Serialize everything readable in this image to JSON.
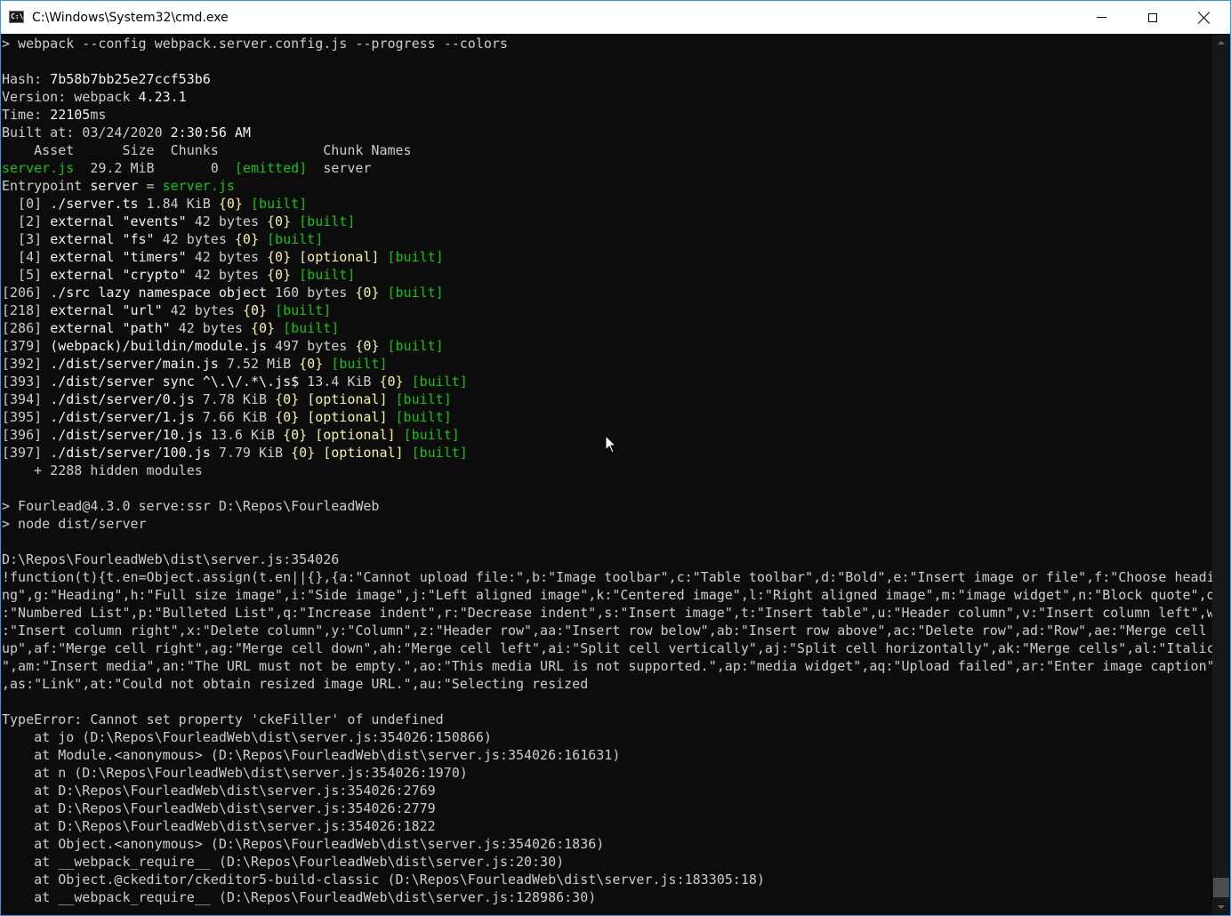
{
  "window": {
    "title": "C:\\Windows\\System32\\cmd.exe",
    "icon_label": "C:\\",
    "icon": "cmd-app-icon"
  },
  "console": {
    "lines": [
      [
        {
          "t": "> webpack --config webpack.server.config.js --progress --colors"
        }
      ],
      [
        {
          "t": ""
        }
      ],
      [
        {
          "t": "Hash: "
        },
        {
          "t": "7b58b7bb25e27ccf53b6",
          "c": "w"
        }
      ],
      [
        {
          "t": "Version: webpack "
        },
        {
          "t": "4.23.1",
          "c": "w"
        }
      ],
      [
        {
          "t": "Time: "
        },
        {
          "t": "22105",
          "c": "w"
        },
        {
          "t": "ms"
        }
      ],
      [
        {
          "t": "Built at: 03/24/2020 "
        },
        {
          "t": "2:30:56 AM",
          "c": "w"
        }
      ],
      [
        {
          "t": "    Asset      Size  Chunks             Chunk Names"
        }
      ],
      [
        {
          "t": "server.js",
          "c": "lg"
        },
        {
          "t": "  29.2 MiB       0  "
        },
        {
          "t": "[emitted]",
          "c": "lg"
        },
        {
          "t": "  server"
        }
      ],
      [
        {
          "t": "Entrypoint "
        },
        {
          "t": "server",
          "c": "w"
        },
        {
          "t": " = "
        },
        {
          "t": "server.js",
          "c": "lg"
        }
      ],
      [
        {
          "t": "  [0] "
        },
        {
          "t": "./server.ts",
          "c": "w"
        },
        {
          "t": " 1.84 KiB "
        },
        {
          "t": "{",
          "c": "y"
        },
        {
          "t": "0",
          "c": "yy"
        },
        {
          "t": "}",
          "c": "y"
        },
        {
          "t": " "
        },
        {
          "t": "[built]",
          "c": "lg"
        }
      ],
      [
        {
          "t": "  [2] "
        },
        {
          "t": "external \"events\"",
          "c": "w"
        },
        {
          "t": " 42 bytes "
        },
        {
          "t": "{0}",
          "c": "yy"
        },
        {
          "t": " "
        },
        {
          "t": "[built]",
          "c": "lg"
        }
      ],
      [
        {
          "t": "  [3] "
        },
        {
          "t": "external \"fs\"",
          "c": "w"
        },
        {
          "t": " 42 bytes "
        },
        {
          "t": "{0}",
          "c": "yy"
        },
        {
          "t": " "
        },
        {
          "t": "[built]",
          "c": "lg"
        }
      ],
      [
        {
          "t": "  [4] "
        },
        {
          "t": "external \"timers\"",
          "c": "w"
        },
        {
          "t": " 42 bytes "
        },
        {
          "t": "{0}",
          "c": "yy"
        },
        {
          "t": " "
        },
        {
          "t": "[optional]",
          "c": "yy"
        },
        {
          "t": " "
        },
        {
          "t": "[built]",
          "c": "lg"
        }
      ],
      [
        {
          "t": "  [5] "
        },
        {
          "t": "external \"crypto\"",
          "c": "w"
        },
        {
          "t": " 42 bytes "
        },
        {
          "t": "{0}",
          "c": "yy"
        },
        {
          "t": " "
        },
        {
          "t": "[built]",
          "c": "lg"
        }
      ],
      [
        {
          "t": "[206] "
        },
        {
          "t": "./src lazy namespace object",
          "c": "w"
        },
        {
          "t": " 160 bytes "
        },
        {
          "t": "{0}",
          "c": "yy"
        },
        {
          "t": " "
        },
        {
          "t": "[built]",
          "c": "lg"
        }
      ],
      [
        {
          "t": "[218] "
        },
        {
          "t": "external \"url\"",
          "c": "w"
        },
        {
          "t": " 42 bytes "
        },
        {
          "t": "{0}",
          "c": "yy"
        },
        {
          "t": " "
        },
        {
          "t": "[built]",
          "c": "lg"
        }
      ],
      [
        {
          "t": "[286] "
        },
        {
          "t": "external \"path\"",
          "c": "w"
        },
        {
          "t": " 42 bytes "
        },
        {
          "t": "{0}",
          "c": "yy"
        },
        {
          "t": " "
        },
        {
          "t": "[built]",
          "c": "lg"
        }
      ],
      [
        {
          "t": "[379] "
        },
        {
          "t": "(webpack)/buildin/module.js",
          "c": "w"
        },
        {
          "t": " 497 bytes "
        },
        {
          "t": "{0}",
          "c": "yy"
        },
        {
          "t": " "
        },
        {
          "t": "[built]",
          "c": "lg"
        }
      ],
      [
        {
          "t": "[392] "
        },
        {
          "t": "./dist/server/main.js",
          "c": "w"
        },
        {
          "t": " 7.52 MiB "
        },
        {
          "t": "{0}",
          "c": "yy"
        },
        {
          "t": " "
        },
        {
          "t": "[built]",
          "c": "lg"
        }
      ],
      [
        {
          "t": "[393] "
        },
        {
          "t": "./dist/server sync ^\\.\\/.*\\.js$",
          "c": "w"
        },
        {
          "t": " 13.4 KiB "
        },
        {
          "t": "{0}",
          "c": "yy"
        },
        {
          "t": " "
        },
        {
          "t": "[built]",
          "c": "lg"
        }
      ],
      [
        {
          "t": "[394] "
        },
        {
          "t": "./dist/server/0.js",
          "c": "w"
        },
        {
          "t": " 7.78 KiB "
        },
        {
          "t": "{0}",
          "c": "yy"
        },
        {
          "t": " "
        },
        {
          "t": "[optional]",
          "c": "yy"
        },
        {
          "t": " "
        },
        {
          "t": "[built]",
          "c": "lg"
        }
      ],
      [
        {
          "t": "[395] "
        },
        {
          "t": "./dist/server/1.js",
          "c": "w"
        },
        {
          "t": " 7.66 KiB "
        },
        {
          "t": "{0}",
          "c": "yy"
        },
        {
          "t": " "
        },
        {
          "t": "[optional]",
          "c": "yy"
        },
        {
          "t": " "
        },
        {
          "t": "[built]",
          "c": "lg"
        }
      ],
      [
        {
          "t": "[396] "
        },
        {
          "t": "./dist/server/10.js",
          "c": "w"
        },
        {
          "t": " 13.6 KiB "
        },
        {
          "t": "{0}",
          "c": "yy"
        },
        {
          "t": " "
        },
        {
          "t": "[optional]",
          "c": "yy"
        },
        {
          "t": " "
        },
        {
          "t": "[built]",
          "c": "lg"
        }
      ],
      [
        {
          "t": "[397] "
        },
        {
          "t": "./dist/server/100.js",
          "c": "w"
        },
        {
          "t": " 7.79 KiB "
        },
        {
          "t": "{0}",
          "c": "yy"
        },
        {
          "t": " "
        },
        {
          "t": "[optional]",
          "c": "yy"
        },
        {
          "t": " "
        },
        {
          "t": "[built]",
          "c": "lg"
        }
      ],
      [
        {
          "t": "    + 2288 hidden modules"
        }
      ],
      [
        {
          "t": ""
        }
      ],
      [
        {
          "t": "> Fourlead@4.3.0 serve:ssr D:\\Repos\\FourleadWeb"
        }
      ],
      [
        {
          "t": "> node dist/server"
        }
      ],
      [
        {
          "t": ""
        }
      ],
      [
        {
          "t": "D:\\Repos\\FourleadWeb\\dist\\server.js:354026"
        }
      ],
      [
        {
          "t": "!function(t){t.en=Object.assign(t.en||{},{a:\"Cannot upload file:\",b:\"Image toolbar\",c:\"Table toolbar\",d:\"Bold\",e:\"Insert image or file\",f:\"Choose headi"
        }
      ],
      [
        {
          "t": "ng\",g:\"Heading\",h:\"Full size image\",i:\"Side image\",j:\"Left aligned image\",k:\"Centered image\",l:\"Right aligned image\",m:\"image widget\",n:\"Block quote\",o"
        }
      ],
      [
        {
          "t": ":\"Numbered List\",p:\"Bulleted List\",q:\"Increase indent\",r:\"Decrease indent\",s:\"Insert image\",t:\"Insert table\",u:\"Header column\",v:\"Insert column left\",w"
        }
      ],
      [
        {
          "t": ":\"Insert column right\",x:\"Delete column\",y:\"Column\",z:\"Header row\",aa:\"Insert row below\",ab:\"Insert row above\",ac:\"Delete row\",ad:\"Row\",ae:\"Merge cell "
        }
      ],
      [
        {
          "t": "up\",af:\"Merge cell right\",ag:\"Merge cell down\",ah:\"Merge cell left\",ai:\"Split cell vertically\",aj:\"Split cell horizontally\",ak:\"Merge cells\",al:\"Italic"
        }
      ],
      [
        {
          "t": "\",am:\"Insert media\",an:\"The URL must not be empty.\",ao:\"This media URL is not supported.\",ap:\"media widget\",aq:\"Upload failed\",ar:\"Enter image caption\""
        }
      ],
      [
        {
          "t": ",as:\"Link\",at:\"Could not obtain resized image URL.\",au:\"Selecting resized"
        }
      ],
      [
        {
          "t": ""
        }
      ],
      [
        {
          "t": "TypeError: Cannot set property 'ckeFiller' of undefined"
        }
      ],
      [
        {
          "t": "    at jo (D:\\Repos\\FourleadWeb\\dist\\server.js:354026:150866)"
        }
      ],
      [
        {
          "t": "    at Module.<anonymous> (D:\\Repos\\FourleadWeb\\dist\\server.js:354026:161631)"
        }
      ],
      [
        {
          "t": "    at n (D:\\Repos\\FourleadWeb\\dist\\server.js:354026:1970)"
        }
      ],
      [
        {
          "t": "    at D:\\Repos\\FourleadWeb\\dist\\server.js:354026:2769"
        }
      ],
      [
        {
          "t": "    at D:\\Repos\\FourleadWeb\\dist\\server.js:354026:2779"
        }
      ],
      [
        {
          "t": "    at D:\\Repos\\FourleadWeb\\dist\\server.js:354026:1822"
        }
      ],
      [
        {
          "t": "    at Object.<anonymous> (D:\\Repos\\FourleadWeb\\dist\\server.js:354026:1836)"
        }
      ],
      [
        {
          "t": "    at __webpack_require__ (D:\\Repos\\FourleadWeb\\dist\\server.js:20:30)"
        }
      ],
      [
        {
          "t": "    at Object.@ckeditor/ckeditor5-build-classic (D:\\Repos\\FourleadWeb\\dist\\server.js:183305:18)"
        }
      ],
      [
        {
          "t": "    at __webpack_require__ (D:\\Repos\\FourleadWeb\\dist\\server.js:128986:30)"
        }
      ]
    ]
  },
  "colors": {
    "background": "#0c0c0c",
    "text": "#cccccc",
    "bright_text": "#f2f2f2",
    "green": "#16c60c",
    "yellow": "#f9f1a5",
    "window_border": "#3a96dd"
  },
  "icons": {
    "minimize": "minimize-icon",
    "maximize": "maximize-icon",
    "close": "close-icon",
    "pointer": "mouse-pointer-icon"
  }
}
